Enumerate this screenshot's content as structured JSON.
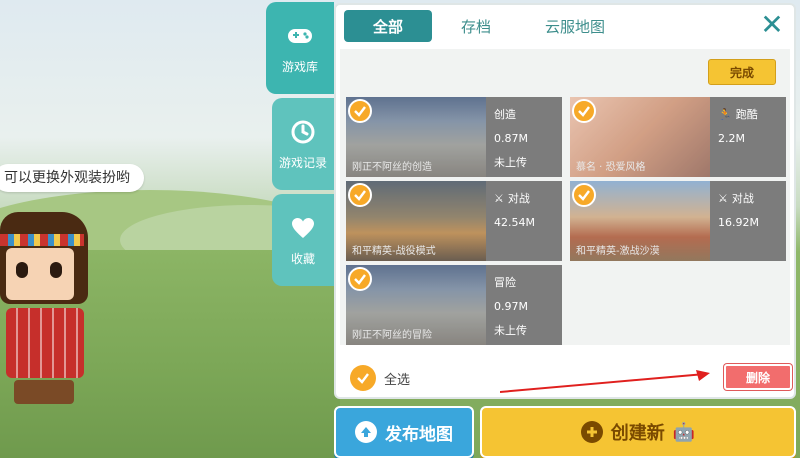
{
  "speech_bubble": "可以更换外观装扮哟",
  "side_tabs": [
    {
      "label": "游戏库",
      "icon": "gamepad-icon",
      "active": true
    },
    {
      "label": "游戏记录",
      "icon": "clock-icon",
      "active": false
    },
    {
      "label": "收藏",
      "icon": "heart-icon",
      "active": false
    }
  ],
  "top_tabs": [
    {
      "label": "全部",
      "active": true
    },
    {
      "label": "存档",
      "active": false
    },
    {
      "label": "云服地图",
      "active": false
    }
  ],
  "close_icon": "close-icon",
  "done_label": "完成",
  "cards": [
    {
      "caption": "刚正不阿丝的创造",
      "mode": "创造",
      "size": "0.87M",
      "status": "未上传",
      "selected": true,
      "thumb": "sky"
    },
    {
      "caption": "慕名 · 恐爱风格",
      "mode": "跑酷",
      "size": "2.2M",
      "status": "",
      "selected": true,
      "thumb": "face"
    },
    {
      "caption": "和平精英-战役模式",
      "mode": "对战",
      "size": "42.54M",
      "status": "",
      "selected": true,
      "thumb": "war"
    },
    {
      "caption": "和平精英-激战沙漠",
      "mode": "对战",
      "size": "16.92M",
      "status": "",
      "selected": true,
      "thumb": "desert"
    },
    {
      "caption": "刚正不阿丝的冒险",
      "mode": "冒险",
      "size": "0.97M",
      "status": "未上传",
      "selected": true,
      "thumb": "sky"
    }
  ],
  "select_all_label": "全选",
  "delete_label": "删除",
  "publish_label": "发布地图",
  "create_label": "创建新",
  "colors": {
    "teal": "#2c8f93",
    "yellow": "#f5c433",
    "check_orange": "#f7a928",
    "delete_red": "#f26d6d",
    "publish_blue": "#3aa6dc",
    "arrow_red": "#e0201e"
  }
}
